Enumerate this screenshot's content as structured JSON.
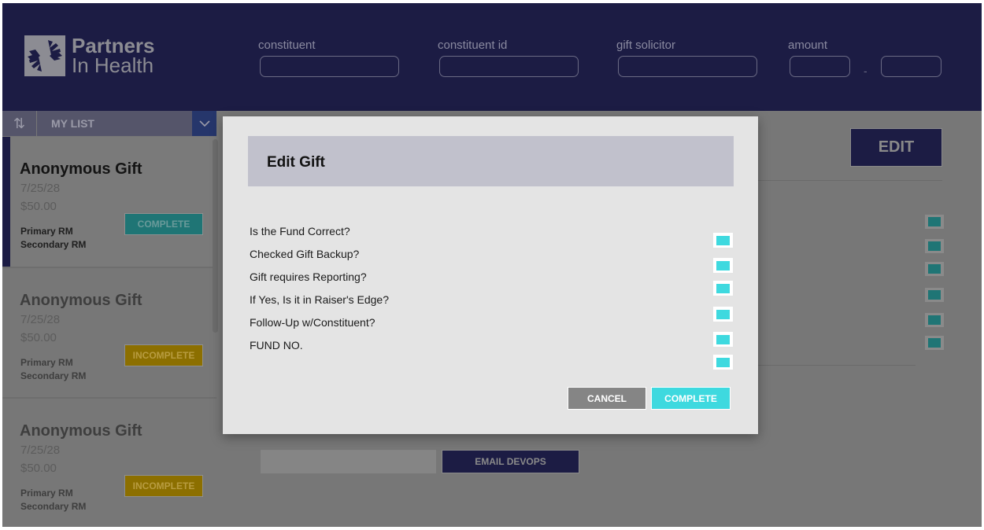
{
  "header": {
    "logo_line1": "Partners",
    "logo_line2": "In Health",
    "filters": [
      {
        "label": "constituent",
        "value": ""
      },
      {
        "label": "constituent id",
        "value": ""
      },
      {
        "label": "gift solicitor",
        "value": ""
      },
      {
        "label": "amount",
        "min_value": "",
        "max_value": "",
        "separator": "-"
      }
    ]
  },
  "sidebar": {
    "sort_icon": "sort-up-down-icon",
    "title": "MY LIST",
    "dropdown_icon": "chevron-down-icon",
    "gifts": [
      {
        "name": "Anonymous Gift",
        "date": "7/25/28",
        "amount": "$50.00",
        "status": "COMPLETE",
        "primary_rm": "Primary RM",
        "secondary_rm": "Secondary RM",
        "selected": true
      },
      {
        "name": "Anonymous Gift",
        "date": "7/25/28",
        "amount": "$50.00",
        "status": "INCOMPLETE",
        "primary_rm": "Primary RM",
        "secondary_rm": "Secondary RM",
        "selected": false
      },
      {
        "name": "Anonymous Gift",
        "date": "7/25/28",
        "amount": "$50.00",
        "status": "INCOMPLETE",
        "primary_rm": "Primary RM",
        "secondary_rm": "Secondary RM",
        "selected": false
      }
    ]
  },
  "main": {
    "edit_label": "EDIT",
    "email_input_value": "",
    "email_button_label": "EMAIL DEVOPS",
    "checkbox_count": 6
  },
  "modal": {
    "title": "Edit Gift",
    "questions": [
      {
        "label": "Is the Fund Correct?",
        "checked": true
      },
      {
        "label": "Checked Gift Backup?",
        "checked": true
      },
      {
        "label": "Gift requires Reporting?",
        "checked": true
      },
      {
        "label": "If Yes, Is it in Raiser's Edge?",
        "checked": true
      },
      {
        "label": "Follow-Up w/Constituent?",
        "checked": true
      },
      {
        "label": "FUND NO.",
        "checked": true
      }
    ],
    "cancel_label": "CANCEL",
    "complete_label": "COMPLETE"
  },
  "colors": {
    "brand_navy": "#1c1c44",
    "accent_teal": "#3ed9df",
    "complete_badge": "#1f7575",
    "incomplete_badge": "#8c6f00",
    "modal_bg": "#e4e4e4",
    "modal_title_bg": "#c1c1cc",
    "overlay_gray": "#777777"
  }
}
